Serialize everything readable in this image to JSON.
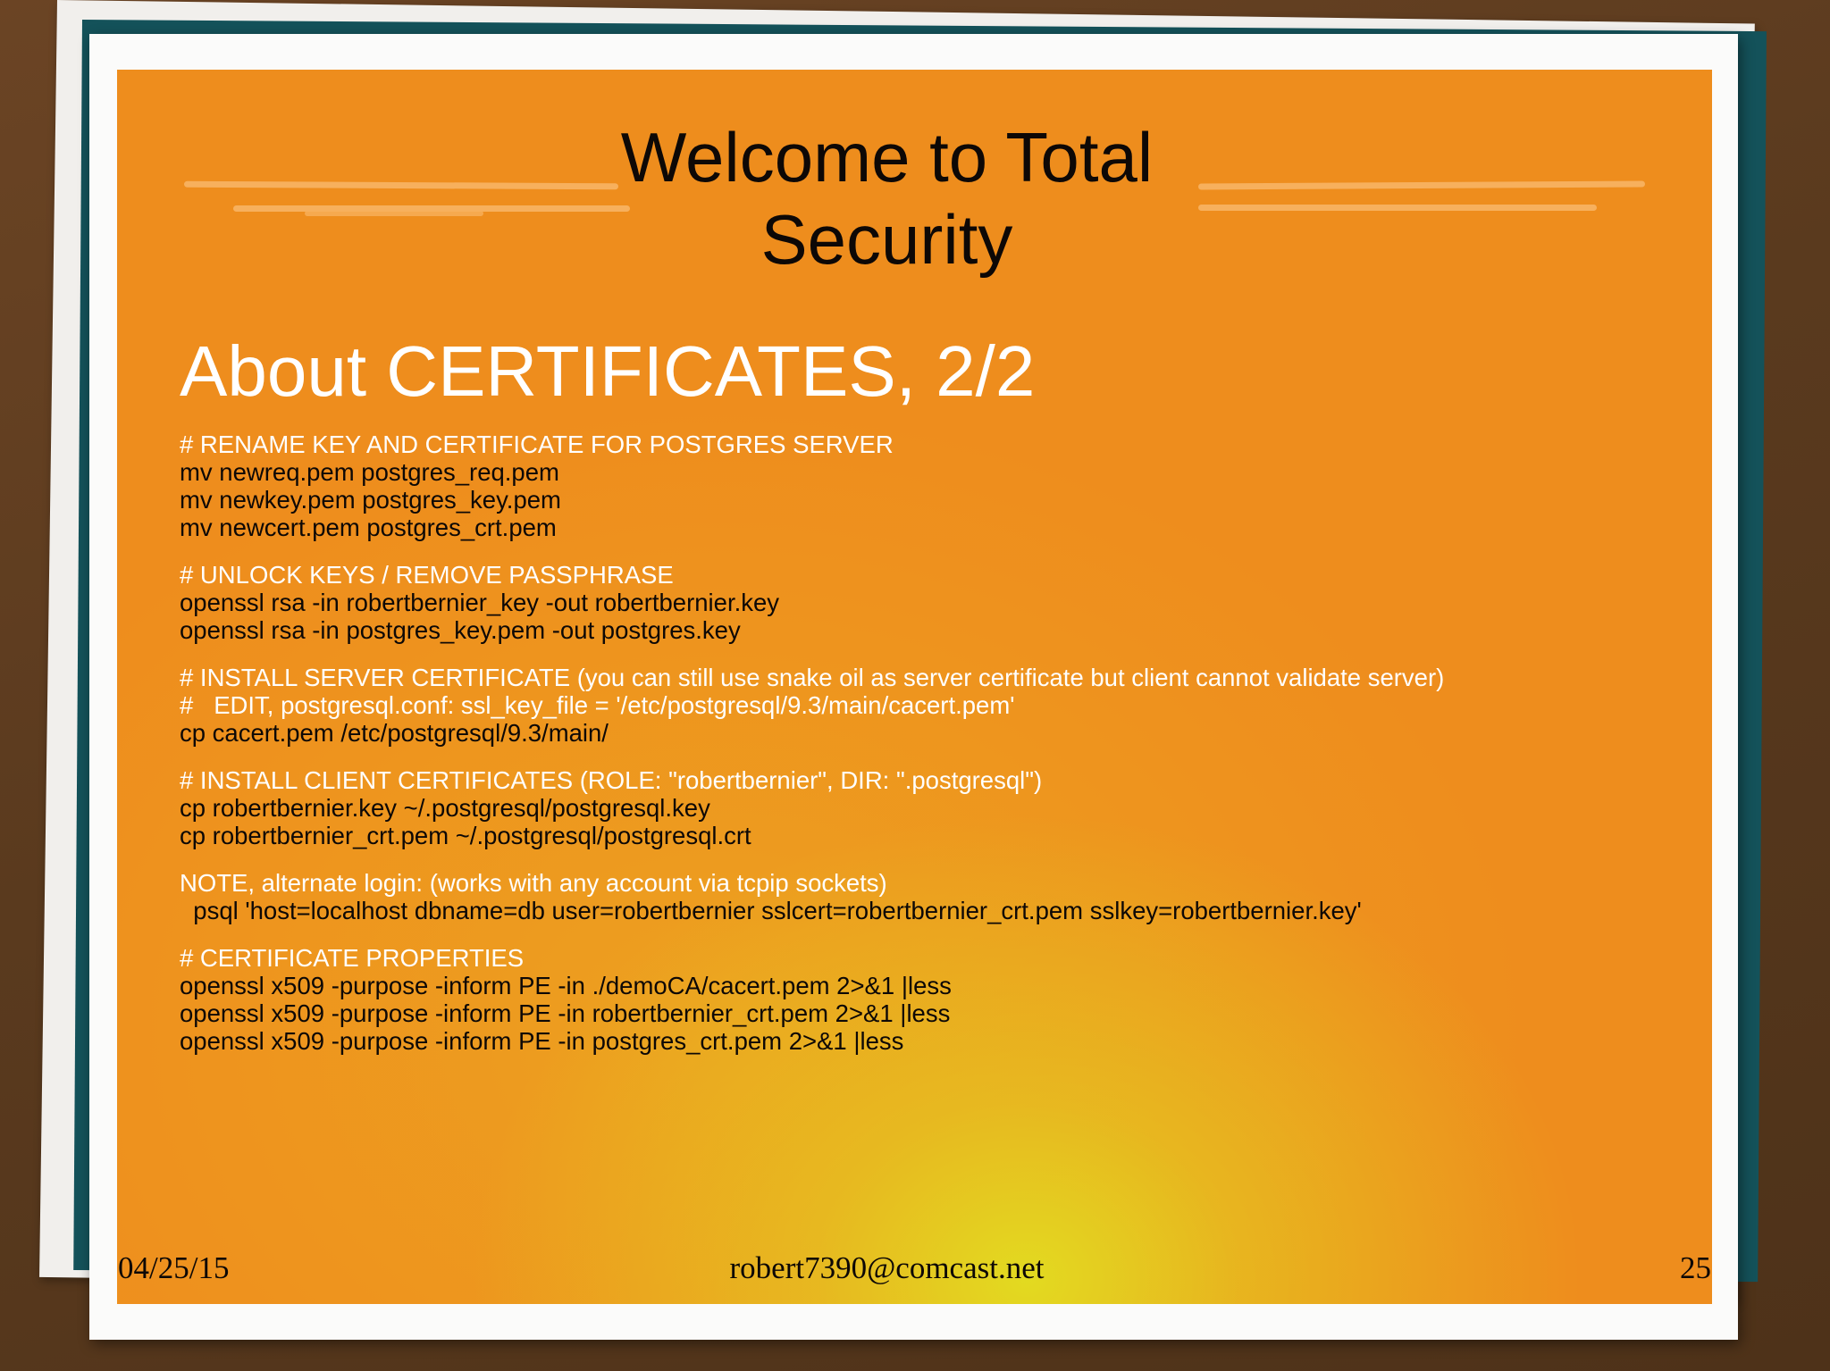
{
  "slide": {
    "title_line1": "Welcome to Total",
    "title_line2": "Security",
    "subtitle": "About CERTIFICATES, 2/2",
    "blocks": [
      {
        "comment": "# RENAME KEY AND CERTIFICATE FOR POSTGRES SERVER",
        "commands": [
          "mv newreq.pem postgres_req.pem",
          "mv newkey.pem postgres_key.pem",
          "mv newcert.pem postgres_crt.pem"
        ]
      },
      {
        "comment": "# UNLOCK KEYS / REMOVE PASSPHRASE",
        "commands": [
          "openssl rsa -in robertbernier_key -out robertbernier.key",
          "openssl rsa -in postgres_key.pem -out postgres.key"
        ]
      },
      {
        "comment": "# INSTALL SERVER CERTIFICATE (you can still use snake oil as server certificate but client cannot validate server)",
        "comment2": "#   EDIT, postgresql.conf: ssl_key_file = '/etc/postgresql/9.3/main/cacert.pem'",
        "commands": [
          "cp cacert.pem /etc/postgresql/9.3/main/"
        ]
      },
      {
        "comment": "# INSTALL CLIENT CERTIFICATES (ROLE: \"robertbernier\", DIR: \".postgresql\")",
        "commands": [
          "cp robertbernier.key ~/.postgresql/postgresql.key",
          "cp robertbernier_crt.pem ~/.postgresql/postgresql.crt"
        ]
      },
      {
        "comment": "NOTE, alternate login: (works with any account via tcpip sockets)",
        "commands": [
          "  psql 'host=localhost dbname=db user=robertbernier sslcert=robertbernier_crt.pem sslkey=robertbernier.key'"
        ]
      },
      {
        "comment": "# CERTIFICATE PROPERTIES",
        "commands": [
          "openssl x509 -purpose -inform PE -in ./demoCA/cacert.pem 2>&1 |less",
          "openssl x509 -purpose -inform PE -in robertbernier_crt.pem 2>&1 |less",
          "openssl x509 -purpose -inform PE -in postgres_crt.pem 2>&1 |less"
        ]
      }
    ]
  },
  "footer": {
    "date": "04/25/15",
    "email": "robert7390@comcast.net",
    "page": "25"
  },
  "colors": {
    "slide_orange": "#ee8d1d",
    "slide_yellow": "#e2de20",
    "teal": "#14525a",
    "wood": "#5a3a1e",
    "comment_text": "#ffffff",
    "command_text": "#0d0806"
  }
}
